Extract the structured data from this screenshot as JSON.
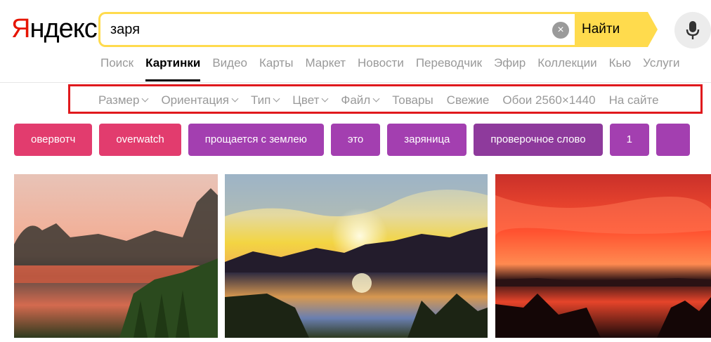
{
  "logo": {
    "first": "Я",
    "rest": "ндекс"
  },
  "search": {
    "query": "заря",
    "button_label": "Найти",
    "clear_glyph": "×"
  },
  "services": [
    "Поиск",
    "Картинки",
    "Видео",
    "Карты",
    "Маркет",
    "Новости",
    "Переводчик",
    "Эфир",
    "Коллекции",
    "Кью",
    "Услуги"
  ],
  "active_service": "Картинки",
  "filters": [
    {
      "label": "Размер",
      "dropdown": true
    },
    {
      "label": "Ориентация",
      "dropdown": true
    },
    {
      "label": "Тип",
      "dropdown": true
    },
    {
      "label": "Цвет",
      "dropdown": true
    },
    {
      "label": "Файл",
      "dropdown": true
    },
    {
      "label": "Товары",
      "dropdown": false
    },
    {
      "label": "Свежие",
      "dropdown": false
    },
    {
      "label": "Обои 2560×1440",
      "dropdown": false
    },
    {
      "label": "На сайте",
      "dropdown": false
    }
  ],
  "chips": [
    {
      "label": "овервотч",
      "color": "#e23c6e"
    },
    {
      "label": "overwatch",
      "color": "#e23c6e"
    },
    {
      "label": "прощается с землею",
      "color": "#a33fb0"
    },
    {
      "label": "это",
      "color": "#a33fb0"
    },
    {
      "label": "заряница",
      "color": "#a33fb0"
    },
    {
      "label": "проверочное слово",
      "color": "#8e3a9c"
    },
    {
      "label": "1",
      "color": "#a33fb0"
    },
    {
      "label": "",
      "color": "#a33fb0"
    }
  ],
  "images": [
    {
      "name": "sunset-image-1",
      "desc_colors": [
        "#f2c6b8",
        "#3d4a2c"
      ]
    },
    {
      "name": "sunset-image-2",
      "desc_colors": [
        "#f7d34a",
        "#2e3a5c"
      ]
    },
    {
      "name": "sunset-image-3",
      "desc_colors": [
        "#ff4b2e",
        "#1a0a0a"
      ]
    }
  ],
  "icons": {
    "mic": "microphone-icon",
    "clear": "clear-icon",
    "chevron": "chevron-down-icon"
  }
}
